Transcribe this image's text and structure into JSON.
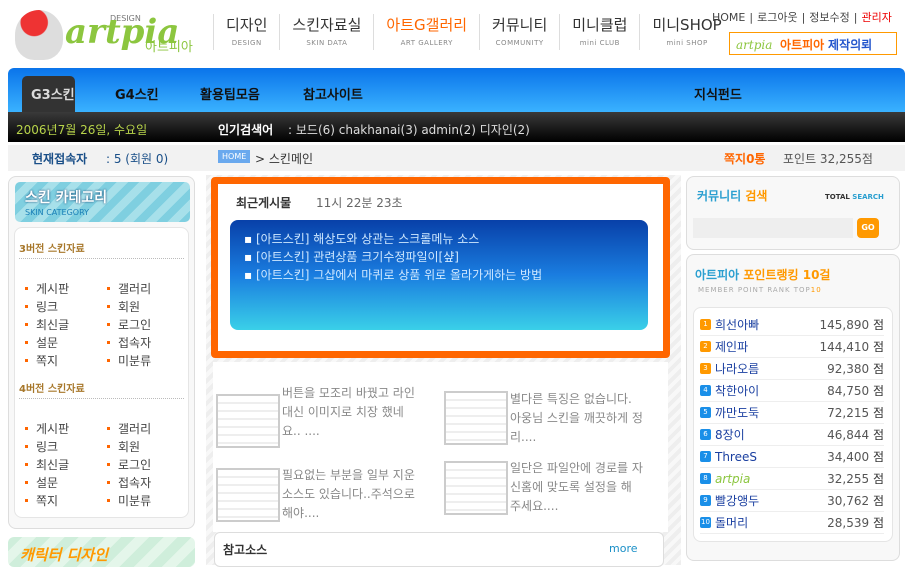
{
  "header": {
    "logo_small": "DESIGN",
    "logo_main": "artpia",
    "logo_korean": "아트피아",
    "nav": [
      {
        "k": "디자인",
        "e": "DESIGN"
      },
      {
        "k": "스킨자료실",
        "e": "SKIN DATA"
      },
      {
        "k": "아트G갤러리",
        "e": "ART GALLERY"
      },
      {
        "k": "커뮤니티",
        "e": "COMMUNITY"
      },
      {
        "k": "미니클럽",
        "e": "mini CLUB"
      },
      {
        "k": "미니SHOP",
        "e": "mini SHOP"
      }
    ],
    "toplinks": [
      "HOME",
      "로그아웃",
      "정보수정",
      "관리자"
    ],
    "banner": {
      "logo": "artpia",
      "text1": "아트피아",
      "text2": "제작의뢰"
    }
  },
  "menu": {
    "tabs": [
      "G3스킨",
      "G4스킨",
      "활용팁모음",
      "참고사이트"
    ],
    "right": "지식펀드"
  },
  "infobar": {
    "date": "2006년7월 26일, 수요일",
    "popular_label": "인기검색어",
    "popular": ": 보드(6) chakhanai(3) admin(2) 디자인(2)"
  },
  "statusbar": {
    "visitors_label": "현재접속자",
    "visitors": ": 5 (회원 0)",
    "home": "HOME",
    "crumb": "> 스킨메인",
    "memo": "쪽지0통",
    "points": "포인트 32,255점"
  },
  "category": {
    "title": "스킨 카테고리",
    "subtitle": "SKIN CATEGORY",
    "sections": [
      {
        "title": "3버전 스킨자료",
        "items": [
          "게시판",
          "갤러리",
          "링크",
          "회원",
          "최신글",
          "로그인",
          "설문",
          "접속자",
          "쪽지",
          "미분류"
        ]
      },
      {
        "title": "4버전 스킨자료",
        "items": [
          "게시판",
          "갤러리",
          "링크",
          "회원",
          "최신글",
          "로그인",
          "설문",
          "접속자",
          "쪽지",
          "미분류"
        ]
      }
    ],
    "character": "캐릭터 디자인"
  },
  "recent": {
    "title": "최근게시물",
    "time": "11시 22분 23초",
    "items": [
      "[아트스킨] 해상도와 상관는 스크롤메뉴 소스",
      "[아트스킨] 관련상품 크기수정파일이[샾]",
      "[아트스킨] 그샵에서 마퀴로 상품 위로 올라가게하는 방법"
    ]
  },
  "posts": [
    "버튼을 모조리 바꿨고 라인 대신 이미지로 치장 했네요.. ....",
    "별다른 특징은 없습니다. 아웅님 스킨을 깨끗하게 정리....",
    "필요없는 부분을 일부 지운 소스도 있습니다..주석으로 해야....",
    "일단은 파일안에 경로를 자신홈에 맞도록 설정을 해 주세요...."
  ],
  "reference": {
    "title": "참고소스",
    "more": "more"
  },
  "search": {
    "title1": "커뮤니티",
    "title2": "검색",
    "total": "TOTAL",
    "search": "SEARCH",
    "go": "GO",
    "value": ""
  },
  "ranking": {
    "title1": "아트피아",
    "title2": "포인트랭킹 10걸",
    "subtitle": "MEMBER POINT RANK TOP",
    "subtitle_num": "10",
    "unit": "점",
    "rows": [
      {
        "r": "1",
        "n": "희선아빠",
        "p": "145,890"
      },
      {
        "r": "2",
        "n": "제인파",
        "p": "144,410"
      },
      {
        "r": "3",
        "n": "나라오름",
        "p": "92,380"
      },
      {
        "r": "4",
        "n": "착한아이",
        "p": "84,750"
      },
      {
        "r": "5",
        "n": "까만도둑",
        "p": "72,215"
      },
      {
        "r": "6",
        "n": "8장이",
        "p": "46,844"
      },
      {
        "r": "7",
        "n": "ThreeS",
        "p": "34,400"
      },
      {
        "r": "8",
        "n": "artpia",
        "p": "32,255"
      },
      {
        "r": "9",
        "n": "빨강앵두",
        "p": "30,762"
      },
      {
        "r": "10",
        "n": "돌머리",
        "p": "28,539"
      }
    ]
  }
}
